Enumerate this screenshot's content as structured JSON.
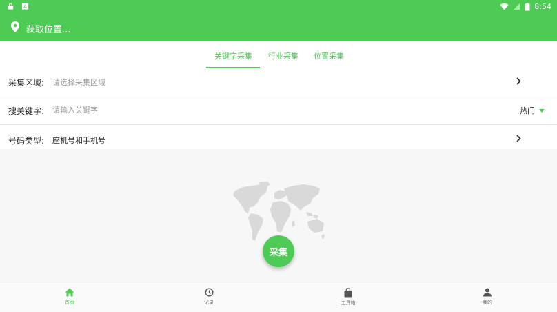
{
  "status_bar": {
    "time": "8:54"
  },
  "app_bar": {
    "title": "获取位置..."
  },
  "tabs": [
    {
      "label": "关键字采集",
      "active": true
    },
    {
      "label": "行业采集",
      "active": false
    },
    {
      "label": "位置采集",
      "active": false
    }
  ],
  "form": {
    "region": {
      "label": "采集区域:",
      "placeholder": "请选择采集区域"
    },
    "keyword": {
      "label": "搜关键字:",
      "placeholder": "请输入关键字",
      "hot_label": "热门"
    },
    "number_type": {
      "label": "号码类型:",
      "value": "座机号和手机号"
    }
  },
  "fab": {
    "label": "采集"
  },
  "bottom_nav": [
    {
      "label": "首页",
      "icon": "home-icon",
      "active": true
    },
    {
      "label": "记录",
      "icon": "history-icon",
      "active": false
    },
    {
      "label": "工具箱",
      "icon": "toolbox-icon",
      "active": false
    },
    {
      "label": "我的",
      "icon": "person-icon",
      "active": false
    }
  ],
  "colors": {
    "accent": "#4ecb55",
    "map_gray": "#d9d9d9"
  }
}
